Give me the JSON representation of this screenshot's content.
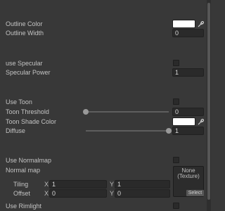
{
  "properties": {
    "outline_color": {
      "label": "Outline Color",
      "color": "#ffffff"
    },
    "outline_width": {
      "label": "Outline Width",
      "value": "0"
    },
    "use_specular": {
      "label": "use Specular",
      "checked": false
    },
    "specular_power": {
      "label": "Specular Power",
      "value": "1"
    },
    "use_toon": {
      "label": "Use Toon",
      "checked": false
    },
    "toon_threshold": {
      "label": "Toon  Threshold",
      "value": "0",
      "slider_fraction": 0.0
    },
    "toon_shade_color": {
      "label": "Toon Shade Color",
      "color": "#ffffff"
    },
    "diffuse": {
      "label": "Diffuse",
      "value": "1",
      "slider_fraction": 1.0
    },
    "use_normalmap": {
      "label": "Use Normalmap",
      "checked": false
    },
    "normal_map": {
      "label": "Normal map",
      "texture_line1": "None",
      "texture_line2": "(Texture)",
      "select_label": "Select"
    },
    "tiling": {
      "label": "Tiling",
      "x_label": "X",
      "x": "1",
      "y_label": "Y",
      "y": "1"
    },
    "offset": {
      "label": "Offset",
      "x_label": "X",
      "x": "0",
      "y_label": "Y",
      "y": "0"
    },
    "use_rimlight": {
      "label": "Use Rimlight",
      "checked": false
    }
  },
  "icons": {
    "eyedropper": "eyedropper-icon"
  }
}
